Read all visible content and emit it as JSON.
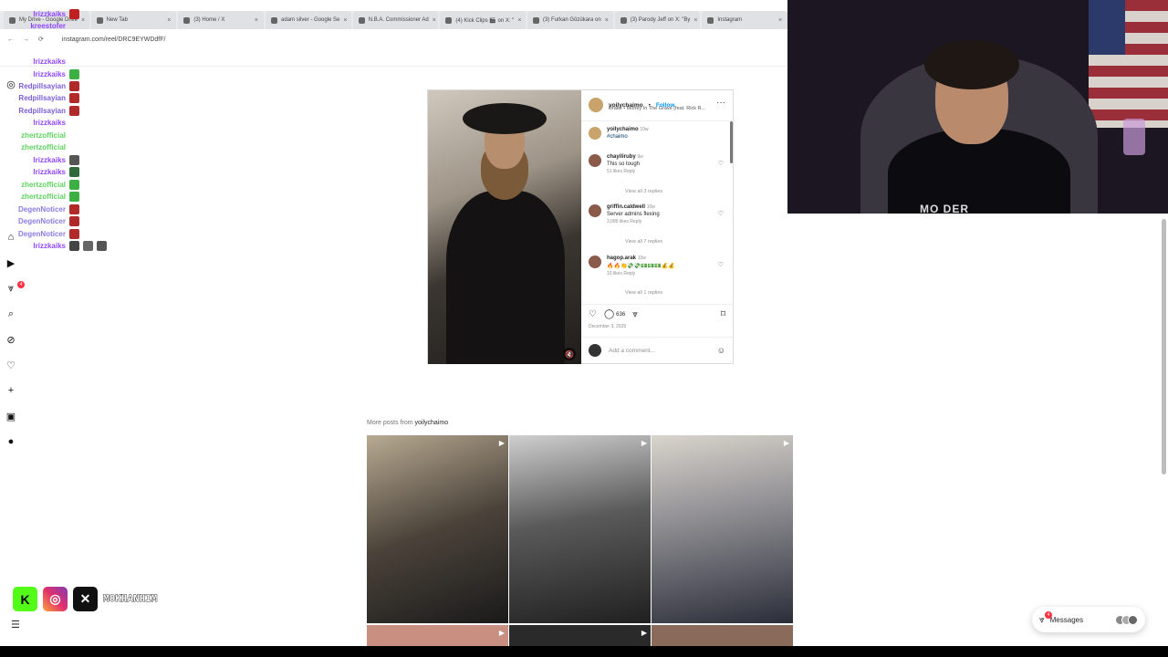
{
  "browser": {
    "tabs": [
      {
        "label": "My Drive - Google Drive"
      },
      {
        "label": "New Tab"
      },
      {
        "label": "(3) Home / X"
      },
      {
        "label": "adam silver - Google Se"
      },
      {
        "label": "N.B.A. Commissioner Ad"
      },
      {
        "label": "(4) Kick Clips 🎬 on X: \""
      },
      {
        "label": "(3) Furkan Gözükara on"
      },
      {
        "label": "(3) Parody Jeff on X: \"By"
      },
      {
        "label": "Instagram"
      }
    ],
    "url": "instagram.com/reel/DRC9EYWDdfF/"
  },
  "chat": [
    {
      "user": "Irizzkaiks",
      "color": "#9147ff",
      "text": "",
      "emotes": [
        "#c02020"
      ]
    },
    {
      "user": "kreestofer",
      "color": "#9147ff",
      "text": "",
      "emotes": []
    },
    {
      "user": "Irizzkaiks",
      "color": "#9147ff",
      "text": "",
      "emotes": []
    },
    {
      "user": "Irizzkaiks",
      "color": "#9147ff",
      "text": "",
      "emotes": [
        "#3cb043"
      ]
    },
    {
      "user": "Redpillsayian",
      "color": "#7b5cd6",
      "text": "",
      "emotes": [
        "#b02a2a"
      ]
    },
    {
      "user": "Redpillsayian",
      "color": "#7b5cd6",
      "text": "",
      "emotes": [
        "#b02a2a"
      ]
    },
    {
      "user": "Redpillsayian",
      "color": "#7b5cd6",
      "text": "",
      "emotes": [
        "#b02a2a"
      ]
    },
    {
      "user": "Irizzkaiks",
      "color": "#9147ff",
      "text": "",
      "emotes": []
    },
    {
      "user": "zhertzofficial",
      "color": "#5fd35f",
      "text": "",
      "emotes": []
    },
    {
      "user": "zhertzofficial",
      "color": "#5fd35f",
      "text": "",
      "emotes": []
    },
    {
      "user": "Irizzkaiks",
      "color": "#9147ff",
      "text": "",
      "emotes": [
        "#555"
      ]
    },
    {
      "user": "Irizzkaiks",
      "color": "#9147ff",
      "text": "",
      "emotes": [
        "#2f6b3a"
      ]
    },
    {
      "user": "zhertzofficial",
      "color": "#5fd35f",
      "text": "",
      "emotes": [
        "#3cb043"
      ]
    },
    {
      "user": "zhertzofficial",
      "color": "#5fd35f",
      "text": "",
      "emotes": [
        "#3cb043"
      ]
    },
    {
      "user": "DegenNoticer",
      "color": "#8c7ce0",
      "text": "",
      "emotes": [
        "#b02a2a"
      ]
    },
    {
      "user": "DegenNoticer",
      "color": "#8c7ce0",
      "text": "",
      "emotes": [
        "#b02a2a"
      ]
    },
    {
      "user": "DegenNoticer",
      "color": "#8c7ce0",
      "text": "",
      "emotes": [
        "#b02a2a"
      ]
    },
    {
      "user": "Irizzkaiks",
      "color": "#9147ff",
      "text": "",
      "emotes": [
        "#444",
        "#666",
        "#555"
      ]
    }
  ],
  "post": {
    "username": "yoilychaimo",
    "follow_label": "Follow",
    "song": "Drake • Money In The Grave (feat. Rick R...",
    "caption_user": "yoilychaimo",
    "caption_time": "10w",
    "caption_tag": "#chaimo",
    "comments": [
      {
        "user": "chayiliruby",
        "time": "9w",
        "text": "This so tough",
        "meta": "51 likes   Reply",
        "view": "View all 3 replies"
      },
      {
        "user": "griffin.caldwell",
        "time": "10w",
        "text": "Server admins flexing",
        "meta": "3,085 likes   Reply",
        "view": "View all 7 replies"
      },
      {
        "user": "hagop.arak",
        "time": "10w",
        "text": "🔥🔥👏💸💸💵💵💵💰💰",
        "meta": "10 likes   Reply",
        "view": "View all 1 replies"
      }
    ],
    "comment_count": "636",
    "date": "December 3, 2025",
    "add_comment_placeholder": "Add a comment..."
  },
  "more_posts": {
    "prefix": "More posts from",
    "user": "yoilychaimo"
  },
  "socials": {
    "handle": "MOKHANHIM"
  },
  "messages": {
    "label": "Messages",
    "badge": "4"
  },
  "notifications_badge": "4",
  "webcam": {
    "shirt_text": "MO DER"
  },
  "colors": {
    "ig_blue": "#0095f6",
    "kick_green": "#53fc18",
    "badge_red": "#ff3040"
  }
}
